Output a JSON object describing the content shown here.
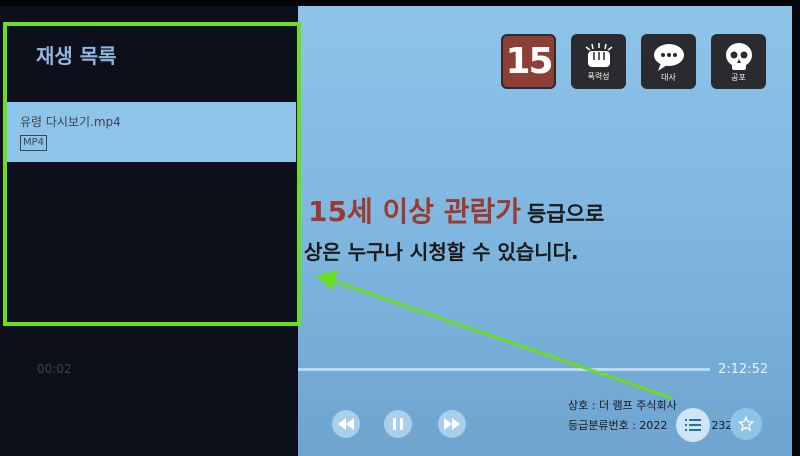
{
  "playlist": {
    "title": "재생 목록",
    "items": [
      {
        "name": "유령 다시보기.mp4",
        "badge": "MP4"
      }
    ]
  },
  "player": {
    "elapsed": "00:02",
    "total": "2:12:52",
    "progress_fraction": 0.0003
  },
  "rating": {
    "age": "15",
    "tiles": [
      {
        "label": "폭력성",
        "icon": "fist-icon"
      },
      {
        "label": "대사",
        "icon": "speech-bubble-icon"
      },
      {
        "label": "공포",
        "icon": "skull-icon"
      }
    ],
    "message_bold": "15세 이상 관람가",
    "message_suffix": "등급으로",
    "message_line2": "상은 누구나 시청할 수 있습니다."
  },
  "company": {
    "line1": "상호 : 더 램프 주식회사",
    "line2_prefix": "등급분류번호 : 2022",
    "line2_suffix": "232"
  },
  "colors": {
    "highlight": "#6bde1f",
    "age_tile": "#8e3f35",
    "selected_item": "#8fc4ea"
  }
}
